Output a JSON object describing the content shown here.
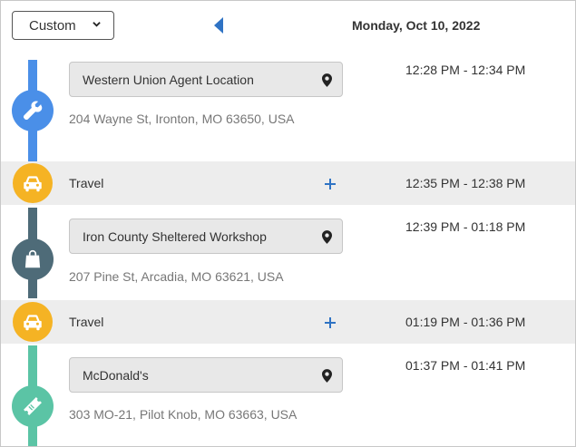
{
  "header": {
    "mode_select_value": "Custom",
    "date": "Monday, Oct 10, 2022"
  },
  "colors": {
    "service": "#4a8fe8",
    "travel": "#f5b324",
    "shopping": "#4e6b78",
    "food": "#5bc4a5",
    "band": "#ededed"
  },
  "stops": [
    {
      "type": "service",
      "icon": "wrench-icon",
      "name": "Western Union Agent Location",
      "address": "204 Wayne St, Ironton, MO 63650, USA",
      "time": "12:28 PM - 12:34 PM"
    },
    {
      "type": "shopping",
      "icon": "shopping-bag-icon",
      "name": "Iron County Sheltered Workshop",
      "address": "207 Pine St, Arcadia, MO 63621, USA",
      "time": "12:39 PM - 01:18 PM"
    },
    {
      "type": "food",
      "icon": "ticket-icon",
      "name": "McDonald's",
      "address": "303 MO-21, Pilot Knob, MO 63663, USA",
      "time": "01:37 PM - 01:41 PM"
    }
  ],
  "travels": [
    {
      "label": "Travel",
      "icon": "car-icon",
      "time": "12:35 PM - 12:38 PM"
    },
    {
      "label": "Travel",
      "icon": "car-icon",
      "time": "01:19 PM - 01:36 PM"
    }
  ]
}
